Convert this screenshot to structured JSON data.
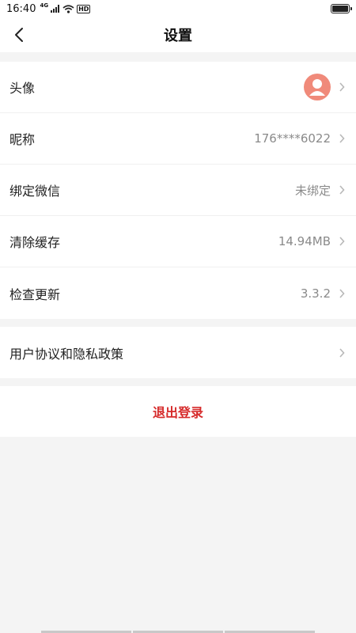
{
  "status_bar": {
    "time": "16:40",
    "network": "4G",
    "hd": "HD",
    "icons": [
      "signal-icon",
      "wifi-icon",
      "hd-icon",
      "battery-icon"
    ]
  },
  "nav": {
    "title": "设置",
    "back_icon": "chevron-left-icon"
  },
  "settings": {
    "avatar": {
      "label": "头像",
      "icon": "user-avatar-icon",
      "avatar_color": "#f08a7a"
    },
    "nickname": {
      "label": "昵称",
      "value": "176****6022"
    },
    "wechat": {
      "label": "绑定微信",
      "value": "未绑定"
    },
    "cache": {
      "label": "清除缓存",
      "value": "14.94MB"
    },
    "update": {
      "label": "检查更新",
      "value": "3.3.2"
    },
    "policy": {
      "label": "用户协议和隐私政策"
    }
  },
  "logout": {
    "label": "退出登录",
    "color": "#d62b2b"
  },
  "colors": {
    "background": "#f4f4f4",
    "card": "#ffffff",
    "value_text": "#8a8a8a",
    "chevron": "#b8b8b8"
  }
}
